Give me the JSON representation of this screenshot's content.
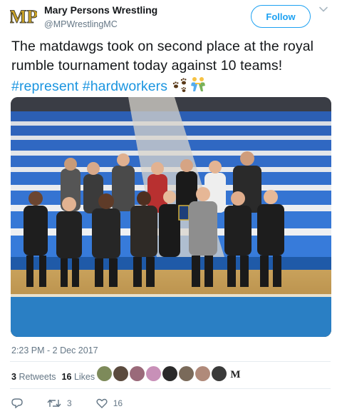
{
  "user": {
    "display_name": "Mary Persons Wrestling",
    "handle": "@MPWrestlingMC",
    "avatar_icon": "mp-logo-icon",
    "avatar_text": "MP"
  },
  "follow_label": "Follow",
  "tweet": {
    "text_parts": [
      {
        "text": "The matdawgs took on second place at the royal rumble tournament today against 10 teams!  ",
        "kind": "plain"
      },
      {
        "text": "#represent",
        "kind": "hash"
      },
      {
        "text": " ",
        "kind": "plain"
      },
      {
        "text": "#hardworkers",
        "kind": "hash"
      },
      {
        "text": " ",
        "kind": "plain"
      }
    ],
    "emojis": [
      "paw-prints-emoji",
      "people-wrestling-emoji"
    ],
    "photo_alt": "team-photo"
  },
  "timestamp": "2:23 PM - 2 Dec 2017",
  "stats": {
    "retweets_count": "3",
    "retweets_label": "Retweets",
    "likes_count": "16",
    "likes_label": "Likes"
  },
  "actions": {
    "reply_icon": "reply-icon",
    "retweet_icon": "retweet-icon",
    "retweet_count": "3",
    "like_icon": "heart-icon",
    "like_count": "16"
  },
  "colors": {
    "accent": "#1da1f2",
    "hashtag": "#1b95e0",
    "muted": "#657786",
    "gold": "#c9a227"
  }
}
